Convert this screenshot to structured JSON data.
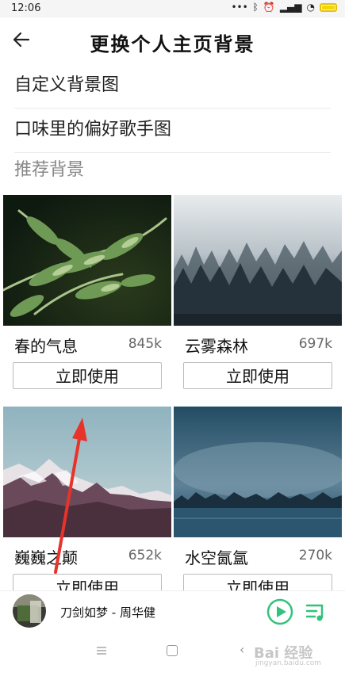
{
  "status_bar": {
    "time": "12:06",
    "icons": [
      "more-dots-icon",
      "bluetooth-icon",
      "alarm-icon",
      "signal-icon",
      "wifi-icon",
      "battery-icon"
    ]
  },
  "header": {
    "back_icon": "back-arrow-icon",
    "title": "更换个人主页背景"
  },
  "menu": [
    {
      "label": "自定义背景图"
    },
    {
      "label": "口味里的偏好歌手图"
    }
  ],
  "section": {
    "title": "推荐背景"
  },
  "backgrounds": [
    {
      "name": "春的气息",
      "count": "845k",
      "button": "立即使用",
      "theme": "cedar-branch"
    },
    {
      "name": "云雾森林",
      "count": "697k",
      "button": "立即使用",
      "theme": "misty-forest"
    },
    {
      "name": "巍巍之颠",
      "count": "652k",
      "button": "立即使用",
      "theme": "snow-mountain"
    },
    {
      "name": "水空氤氲",
      "count": "270k",
      "button": "立即使用",
      "theme": "foggy-lake"
    }
  ],
  "player": {
    "track": "刀剑如梦 - 周华健",
    "play_icon": "play-circle-icon",
    "playlist_icon": "playlist-icon",
    "accent_color": "#31c27c"
  },
  "annotation": {
    "color": "#e8332b"
  },
  "watermark": {
    "text": "Bai 经验",
    "subtext": "jingyan.baidu.com"
  }
}
